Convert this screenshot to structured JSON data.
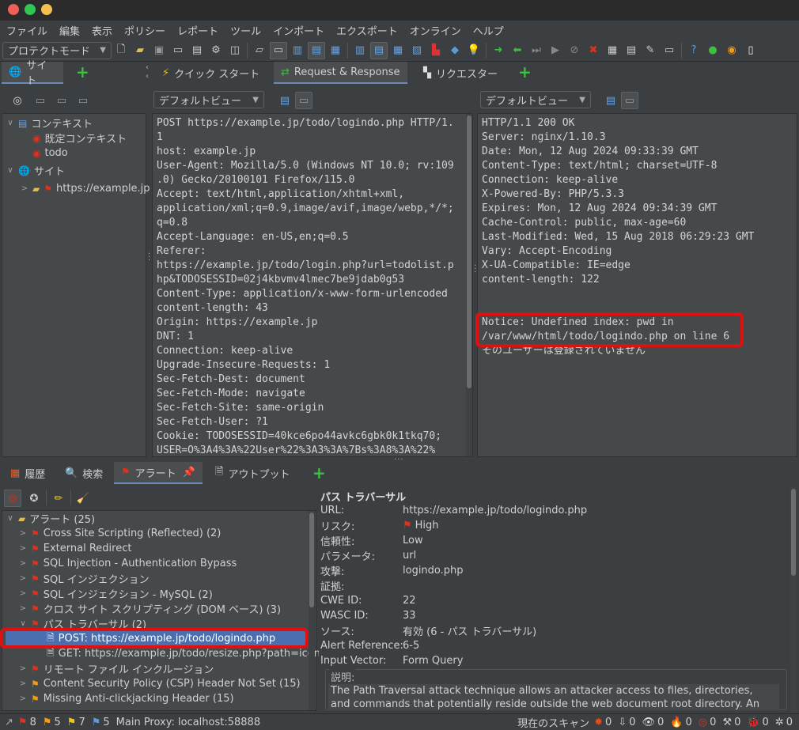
{
  "menu": [
    "ファイル",
    "編集",
    "表示",
    "ポリシー",
    "レポート",
    "ツール",
    "インポート",
    "エクスポート",
    "オンライン",
    "ヘルプ"
  ],
  "toolbar": {
    "mode": "プロテクトモード"
  },
  "left_tabs": {
    "site": "サイト"
  },
  "main_tabs": {
    "quick_start": "クイック スタート",
    "req_resp": "Request & Response",
    "requester": "リクエスター"
  },
  "view_select": {
    "request": "デフォルトビュー",
    "response": "デフォルトビュー"
  },
  "tree": {
    "contexts": "コンテキスト",
    "default_context": "既定コンテキスト",
    "todo": "todo",
    "sites": "サイト",
    "site_url": "https://example.jp"
  },
  "request_text": "POST https://example.jp/todo/logindo.php HTTP/1.\n1\nhost: example.jp\nUser-Agent: Mozilla/5.0 (Windows NT 10.0; rv:109\n.0) Gecko/20100101 Firefox/115.0\nAccept: text/html,application/xhtml+xml,\napplication/xml;q=0.9,image/avif,image/webp,*/*;\nq=0.8\nAccept-Language: en-US,en;q=0.5\nReferer:\nhttps://example.jp/todo/login.php?url=todolist.p\nhp&TODOSESSID=02j4kbvmv4lmec7be9jdab0g53\nContent-Type: application/x-www-form-urlencoded\ncontent-length: 43\nOrigin: https://example.jp\nDNT: 1\nConnection: keep-alive\nUpgrade-Insecure-Requests: 1\nSec-Fetch-Dest: document\nSec-Fetch-Mode: navigate\nSec-Fetch-Site: same-origin\nSec-Fetch-User: ?1\nCookie: TODOSESSID=40kce6po44avkc6gbk0k1tkq70;\nUSER=O%3A4%3A%22User%22%3A3%3A%7Bs%3A8%3A%22%",
  "response_text": "HTTP/1.1 200 OK\nServer: nginx/1.10.3\nDate: Mon, 12 Aug 2024 09:33:39 GMT\nContent-Type: text/html; charset=UTF-8\nConnection: keep-alive\nX-Powered-By: PHP/5.3.3\nExpires: Mon, 12 Aug 2024 09:34:39 GMT\nCache-Control: public, max-age=60\nLast-Modified: Wed, 15 Aug 2018 06:29:23 GMT\nVary: Accept-Encoding\nX-UA-Compatible: IE=edge\ncontent-length: 122\n\n\nNotice: Undefined index: pwd in\n/var/www/html/todo/logindo.php on line 6\nそのユーザーは登録されていません",
  "bottom_tabs": {
    "history": "履歴",
    "search": "検索",
    "alerts": "アラート",
    "output": "アウトプット"
  },
  "alerts": {
    "root": "アラート (25)",
    "items": [
      "Cross Site Scripting (Reflected) (2)",
      "External Redirect",
      "SQL Injection - Authentication Bypass",
      "SQL インジェクション",
      "SQL インジェクション - MySQL (2)",
      "クロス サイト スクリプティング (DOM ベース) (3)",
      "パス トラバーサル (2)",
      "POST: https://example.jp/todo/logindo.php",
      "GET: https://example.jp/todo/resize.php?path=icon",
      "リモート ファイル インクルージョン",
      "Content Security Policy (CSP) Header Not Set (15)",
      "Missing Anti-clickjacking Header (15)"
    ]
  },
  "detail": {
    "title": "パス トラバーサル",
    "rows": [
      {
        "k": "URL:",
        "v": "https://example.jp/todo/logindo.php"
      },
      {
        "k": "リスク:",
        "v": "High"
      },
      {
        "k": "信頼性:",
        "v": "Low"
      },
      {
        "k": "パラメータ:",
        "v": "url"
      },
      {
        "k": "攻撃:",
        "v": "logindo.php"
      },
      {
        "k": "証拠:",
        "v": ""
      },
      {
        "k": "CWE ID:",
        "v": "22"
      },
      {
        "k": "WASC ID:",
        "v": "33"
      },
      {
        "k": "ソース:",
        "v": "有効 (6 - パス トラバーサル)"
      },
      {
        "k": "Alert Reference:",
        "v": "6-5"
      },
      {
        "k": "Input Vector:",
        "v": "Form Query"
      }
    ],
    "desc_label": "説明:",
    "desc_text": "The Path Traversal attack technique allows an attacker access to files, directories,\nand commands that potentially reside outside the web document root directory. An"
  },
  "status": {
    "red": "8",
    "orange": "5",
    "yellow": "7",
    "blue": "5",
    "proxy": "Main Proxy: localhost:58888",
    "scan_label": "現在のスキャン",
    "counts": [
      "0",
      "0",
      "0",
      "0",
      "0",
      "0",
      "0",
      "0"
    ]
  }
}
